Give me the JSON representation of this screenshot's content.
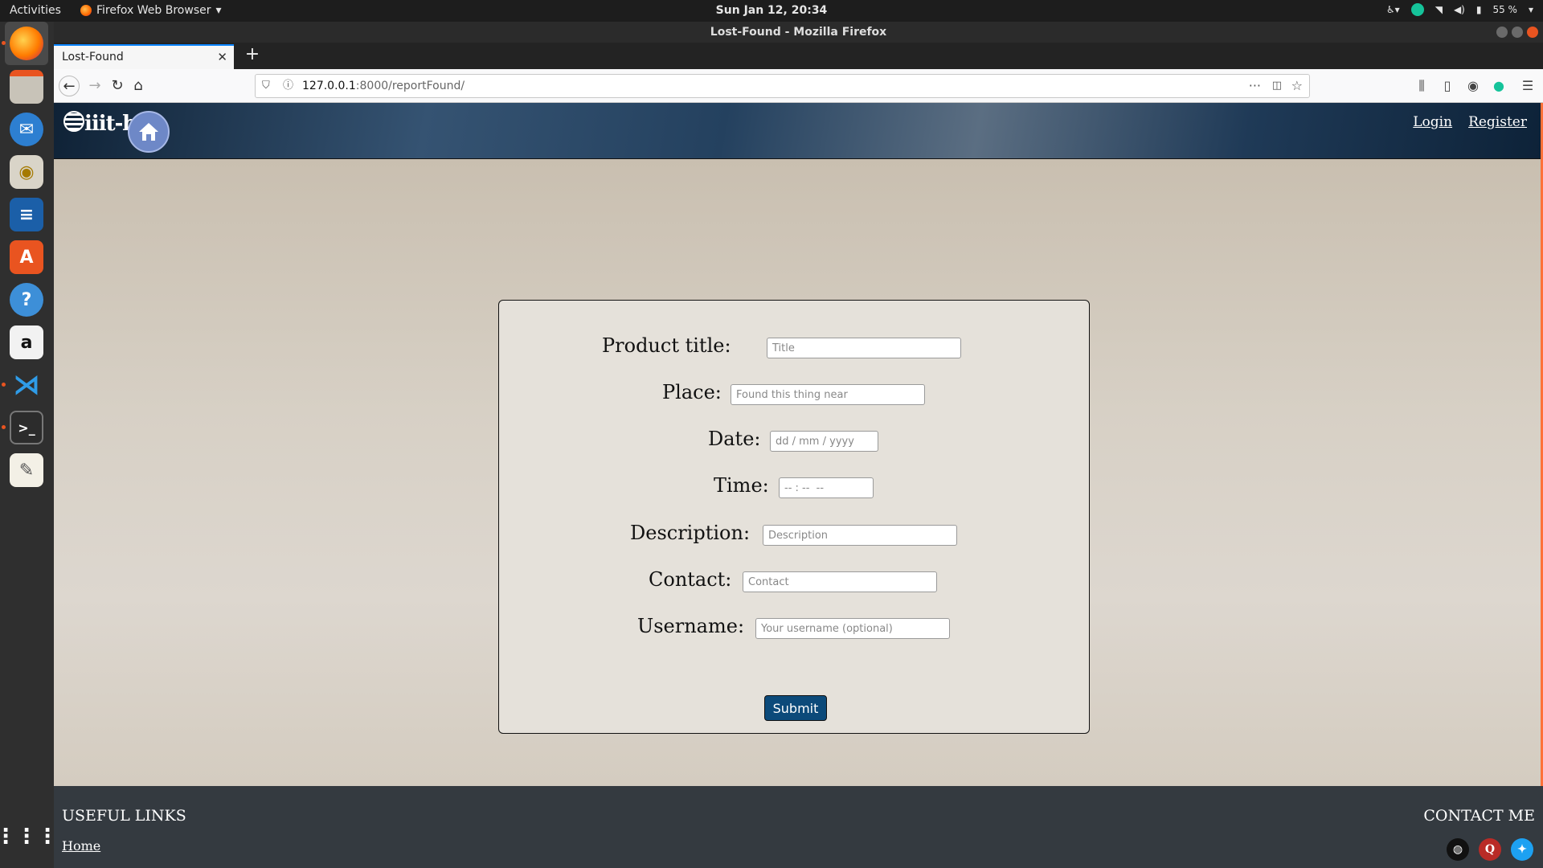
{
  "topbar": {
    "activities": "Activities",
    "app_menu": "Firefox Web Browser",
    "clock": "Sun Jan 12, 20:34",
    "battery": "55 %"
  },
  "dock": {
    "items": [
      "firefox-icon",
      "files-icon",
      "thunderbird-icon",
      "rhythmbox-icon",
      "writer-icon",
      "software-icon",
      "help-icon",
      "amazon-icon",
      "vscode-icon",
      "terminal-icon",
      "text-editor-icon",
      "apps-grid-icon"
    ]
  },
  "browser": {
    "window_title": "Lost-Found - Mozilla Firefox",
    "tab_title": "Lost-Found",
    "url_host": "127.0.0.1",
    "url_path": ":8000/reportFound/"
  },
  "site": {
    "logo_text": "iiit-b",
    "nav": {
      "login": "Login",
      "register": "Register"
    },
    "form": {
      "product_title_label": "Product title:",
      "product_title_placeholder": "Title",
      "place_label": "Place:",
      "place_placeholder": "Found this thing near",
      "date_label": "Date:",
      "date_placeholder": "dd / mm / yyyy",
      "time_label": "Time:",
      "time_placeholder": "-- : --  --",
      "description_label": "Description:",
      "description_placeholder": "Description",
      "contact_label": "Contact:",
      "contact_placeholder": "Contact",
      "username_label": "Username:",
      "username_placeholder": "Your username (optional)",
      "submit": "Submit"
    },
    "footer": {
      "useful_links": "USEFUL LINKS",
      "home": "Home",
      "contact_me": "CONTACT ME"
    }
  },
  "colors": {
    "accent": "#e95420",
    "submit_bg": "#0c4a7a",
    "footer_bg": "#343a40"
  }
}
